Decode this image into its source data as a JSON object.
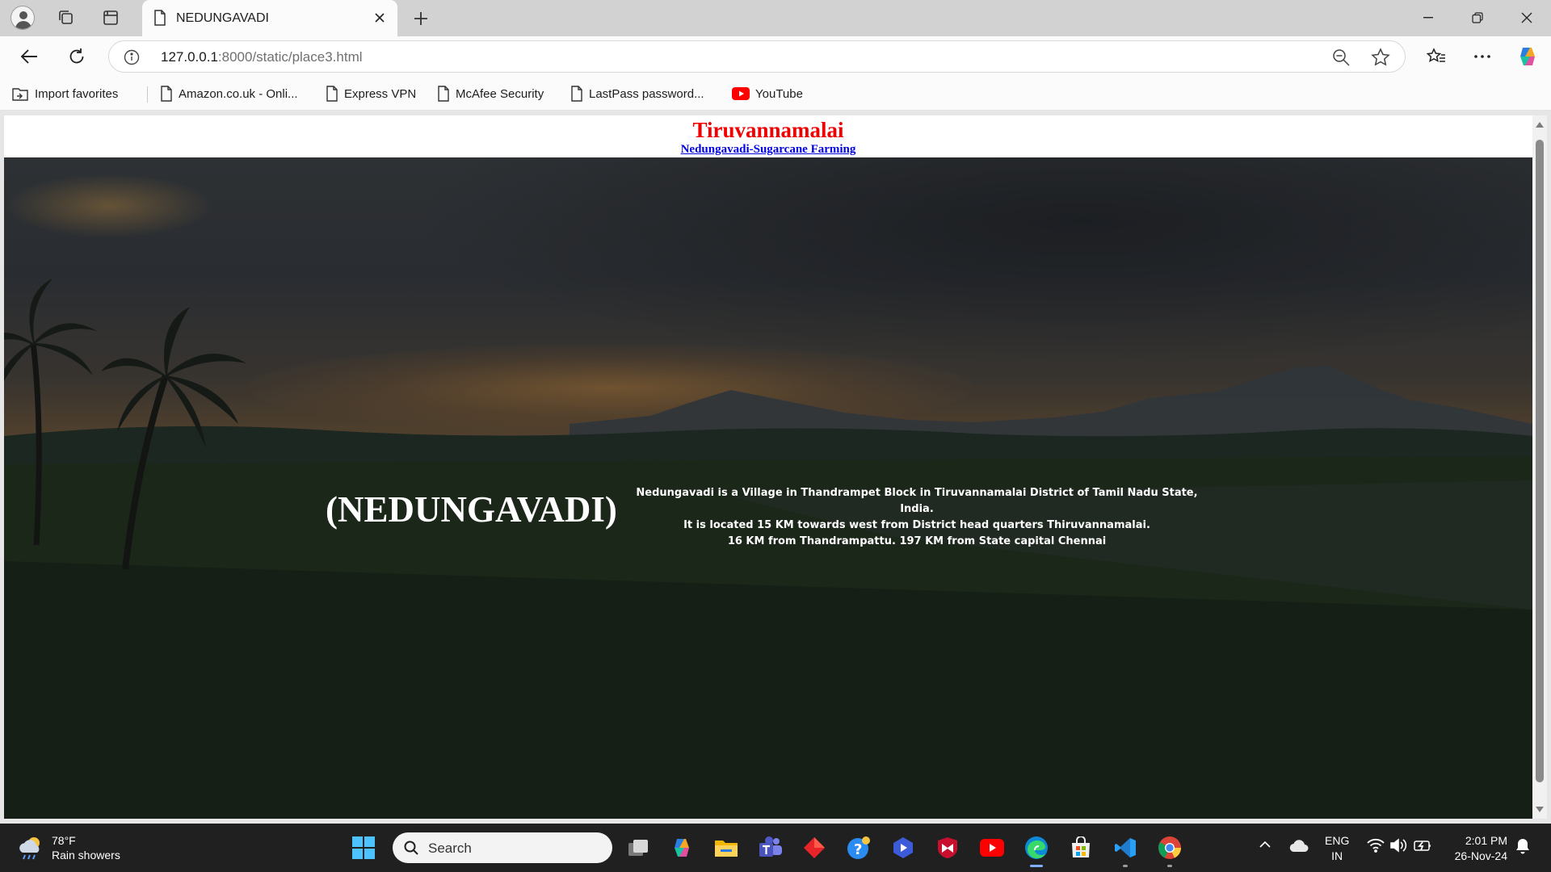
{
  "browser": {
    "tab": {
      "title": "NEDUNGAVADI"
    },
    "url": {
      "host": "127.0.0.1",
      "rest": ":8000/static/place3.html"
    },
    "favorites": [
      {
        "label": "Import favorites",
        "icon": "import-favorites-icon"
      },
      {
        "label": "Amazon.co.uk - Onli...",
        "icon": "page-icon"
      },
      {
        "label": "Express VPN",
        "icon": "page-icon"
      },
      {
        "label": "McAfee Security",
        "icon": "page-icon"
      },
      {
        "label": "LastPass password...",
        "icon": "page-icon"
      },
      {
        "label": "YouTube",
        "icon": "youtube-icon"
      }
    ]
  },
  "page": {
    "title": "Tiruvannamalai",
    "subtitle": "Nedungavadi-Sugarcane Farming",
    "place_name": "(NEDUNGAVADI)",
    "description": [
      "Nedungavadi is a Village in Thandrampet Block in Tiruvannamalai District of Tamil Nadu State, India.",
      "It is located 15 KM towards west from District head quarters Thiruvannamalai.",
      "16 KM from Thandrampattu. 197 KM from State capital Chennai"
    ]
  },
  "taskbar": {
    "weather": {
      "temp": "78°F",
      "condition": "Rain showers"
    },
    "search_placeholder": "Search",
    "lang": {
      "line1": "ENG",
      "line2": "IN"
    },
    "clock": {
      "time": "2:01 PM",
      "date": "26-Nov-24"
    }
  },
  "colors": {
    "title": "#f00000",
    "subtitle": "#0000e0",
    "taskbar": "#202020"
  }
}
